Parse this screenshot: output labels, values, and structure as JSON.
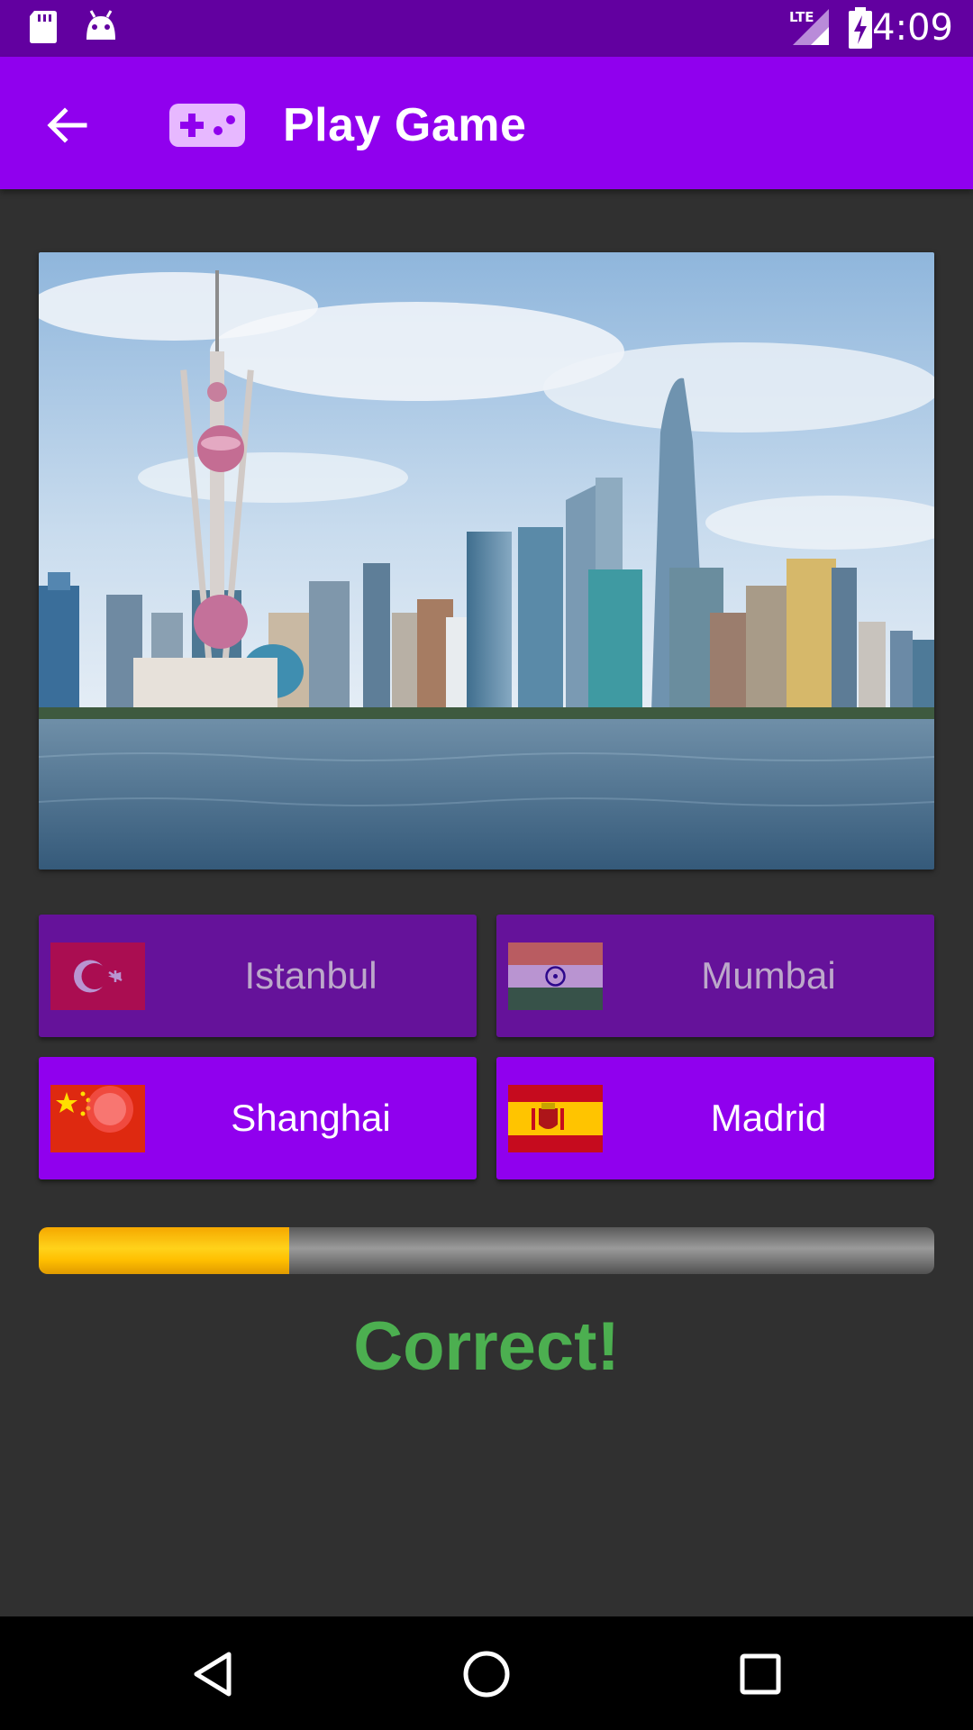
{
  "status_bar": {
    "time": "4:09",
    "network": "LTE",
    "icons": [
      "sd-card-icon",
      "android-icon",
      "signal-icon",
      "battery-charging-icon"
    ]
  },
  "app_bar": {
    "title": "Play Game",
    "back_icon": "arrow-back-icon",
    "logo_icon": "gamepad-icon"
  },
  "question": {
    "image": "city-skyline-photo"
  },
  "answers": [
    {
      "label": "Istanbul",
      "flag": "turkey-flag",
      "enabled": false
    },
    {
      "label": "Mumbai",
      "flag": "india-flag",
      "enabled": false
    },
    {
      "label": "Shanghai",
      "flag": "china-flag",
      "enabled": true
    },
    {
      "label": "Madrid",
      "flag": "spain-flag",
      "enabled": true
    }
  ],
  "progress": {
    "fraction": 0.28
  },
  "result_text": "Correct!",
  "colors": {
    "primary": "#9000ee",
    "primary_dark": "#6200a0",
    "disabled_button": "#65129a",
    "background": "#303030",
    "correct": "#4caf50",
    "progress_fill": "#ffc107"
  },
  "nav_bar": {
    "back": "nav-back-icon",
    "home": "nav-home-icon",
    "recents": "nav-recents-icon"
  }
}
